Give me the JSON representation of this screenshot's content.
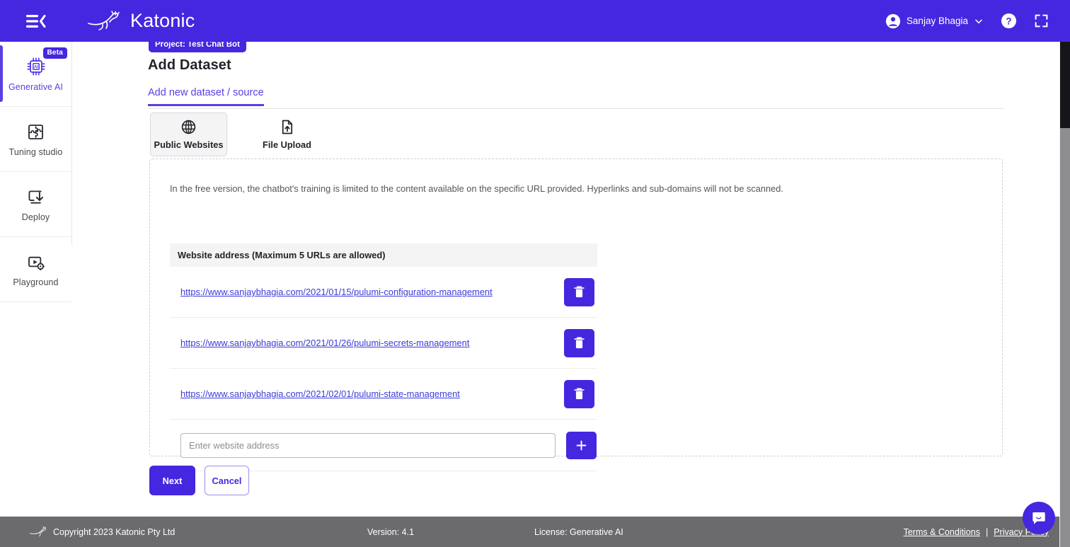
{
  "header": {
    "collapse_icon": "menu-collapse-icon",
    "brand": "Katonic",
    "user_name": "Sanjay Bhagia",
    "user_icon": "account-circle-icon",
    "chevron_icon": "chevron-down-icon",
    "help_icon": "help-circle-icon",
    "fullscreen_icon": "fullscreen-icon",
    "accent": "#4527e0"
  },
  "sidebar": {
    "items": [
      {
        "label": "Generative AI",
        "icon": "ai-chip-icon",
        "badge": "Beta",
        "active": true
      },
      {
        "label": "Tuning studio",
        "icon": "puzzle-icon",
        "badge": "",
        "active": false
      },
      {
        "label": "Deploy",
        "icon": "deploy-download-icon",
        "badge": "",
        "active": false
      },
      {
        "label": "Playground",
        "icon": "playground-gear-icon",
        "badge": "",
        "active": false
      }
    ]
  },
  "main": {
    "breadcrumb": "Project: Test Chat Bot",
    "page_title": "Add Dataset",
    "tab_label": "Add new dataset / source",
    "source_tabs": [
      {
        "label": "Public Websites",
        "icon": "globe-icon",
        "selected": true
      },
      {
        "label": "File Upload",
        "icon": "file-upload-icon",
        "selected": false
      }
    ],
    "note": "In the free version, the chatbot's training is limited to the content available on the specific URL provided. Hyperlinks and sub-domains will not be scanned.",
    "address_header": "Website address (Maximum 5 URLs are allowed)",
    "urls": [
      "https://www.sanjaybhagia.com/2021/01/15/pulumi-configuration-management",
      "https://www.sanjaybhagia.com/2021/01/26/pulumi-secrets-management",
      "https://www.sanjaybhagia.com/2021/02/01/pulumi-state-management"
    ],
    "delete_icon": "trash-icon",
    "add_icon": "plus-icon",
    "input_placeholder": "Enter website address",
    "input_value": "",
    "next_label": "Next",
    "cancel_label": "Cancel"
  },
  "footer": {
    "logo_icon": "kangaroo-logo-icon",
    "copyright": "Copyright 2023 Katonic Pty Ltd",
    "version": "Version: 4.1",
    "license": "License: Generative AI",
    "terms": "Terms & Conditions",
    "separator": "|",
    "privacy": "Privacy Policy"
  },
  "chat": {
    "icon": "chat-bubble-icon"
  }
}
